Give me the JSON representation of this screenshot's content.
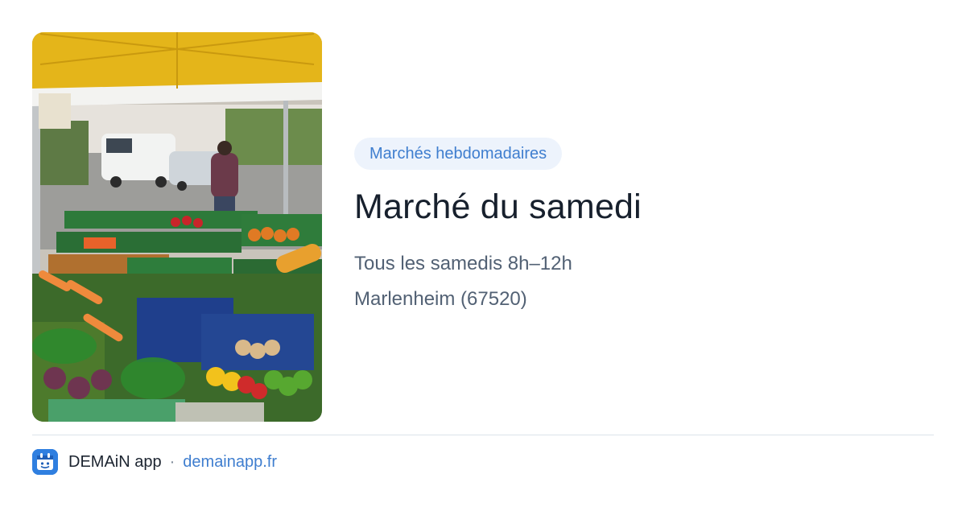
{
  "card": {
    "image": {
      "alt": "",
      "icon": "market-photo"
    },
    "category": "Marchés hebdomadaires",
    "title": "Marché du samedi",
    "schedule": "Tous les samedis 8h–12h",
    "location": "Marlenheim (67520)"
  },
  "footer": {
    "logo_icon": "demain-app-logo-icon",
    "brand": "DEMAiN app",
    "separator": "·",
    "domain": "demainapp.fr"
  },
  "colors": {
    "accent": "#3f7ecf",
    "tag_background": "#edf3fc",
    "title": "#17202d",
    "secondary_text": "#526174",
    "divider": "#dbe3ea",
    "logo_background": "#2f7fe0"
  }
}
